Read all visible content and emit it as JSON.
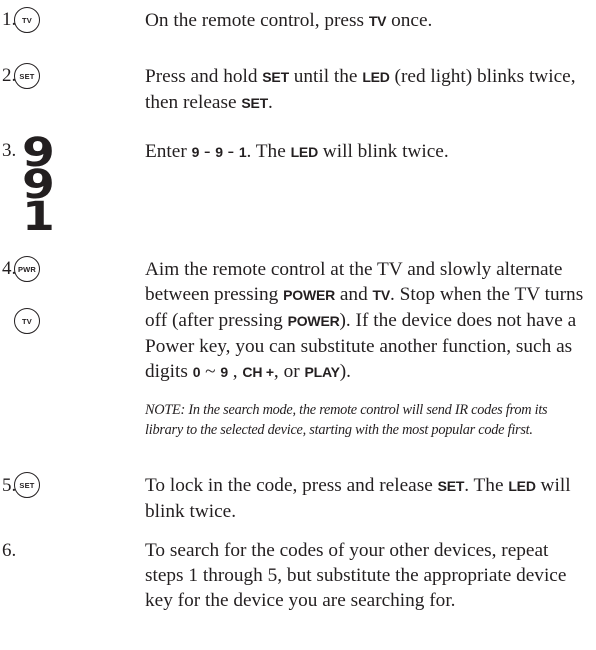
{
  "steps": [
    {
      "num": "1.",
      "keys": [
        "TV"
      ],
      "text": [
        {
          "t": "On the remote control, press "
        },
        {
          "b": "TV"
        },
        {
          "t": " once."
        }
      ]
    },
    {
      "num": "2.",
      "keys": [
        "SET"
      ],
      "text": [
        {
          "t": "Press and hold "
        },
        {
          "b": "SET"
        },
        {
          "t": " until the "
        },
        {
          "b": "LED"
        },
        {
          "t": " (red light) blinks twice, then release "
        },
        {
          "b": "SET"
        },
        {
          "t": "."
        }
      ]
    },
    {
      "num": "3.",
      "digits": [
        "9",
        "9",
        "1"
      ],
      "text": [
        {
          "t": "Enter "
        },
        {
          "b": "9"
        },
        {
          "t": " -  "
        },
        {
          "b": "9"
        },
        {
          "t": " - "
        },
        {
          "b": "1"
        },
        {
          "t": ". The "
        },
        {
          "b": "LED"
        },
        {
          "t": " will blink twice."
        }
      ]
    },
    {
      "num": "4.",
      "keys": [
        "PWR",
        "TV"
      ],
      "text": [
        {
          "t": "Aim the remote control at the TV and slowly alternate between pressing "
        },
        {
          "b": "POWER"
        },
        {
          "t": " and "
        },
        {
          "b": "TV"
        },
        {
          "t": ". Stop when the TV turns off (after pressing "
        },
        {
          "b": "POWER"
        },
        {
          "t": "). If the device does not have a Power key, you can substitute another function, such as digits "
        },
        {
          "b": "0"
        },
        {
          "t": " ~ "
        },
        {
          "b": "9"
        },
        {
          "t": " , "
        },
        {
          "b": "CH +"
        },
        {
          "t": ", or "
        },
        {
          "b": "PLAY"
        },
        {
          "t": ")."
        }
      ],
      "note": "NOTE: In the search mode, the remote control will send IR codes from its library to the selected device, starting with the most popular code first."
    },
    {
      "num": "5.",
      "keys": [
        "SET"
      ],
      "text": [
        {
          "t": "To lock in the code, press and release "
        },
        {
          "b": "SET"
        },
        {
          "t": ". The "
        },
        {
          "b": "LED"
        },
        {
          "t": " will blink twice."
        }
      ]
    },
    {
      "num": "6.",
      "text": [
        {
          "t": "To search for the codes of your other devices, repeat steps 1 through 5, but substitute the appropriate device key for the device you are searching for."
        }
      ]
    }
  ]
}
